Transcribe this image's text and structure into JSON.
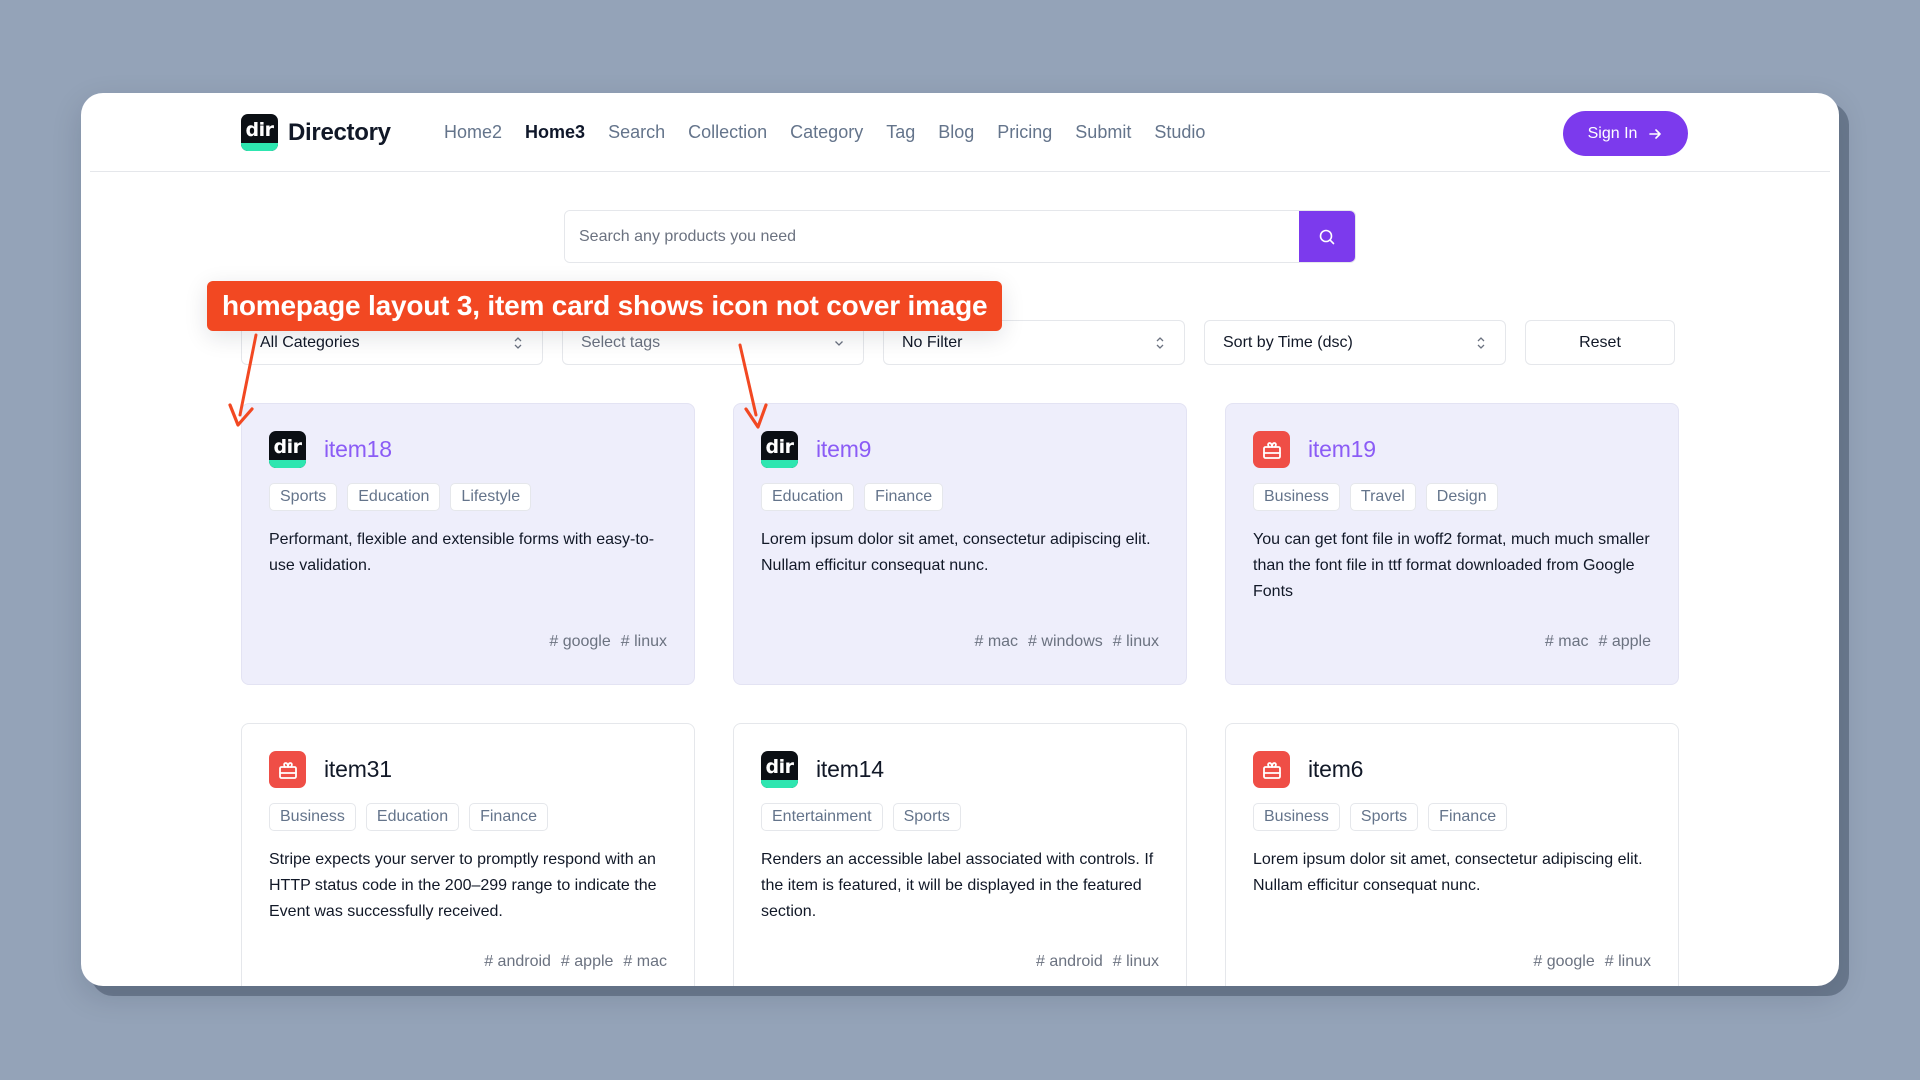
{
  "header": {
    "brand": "Directory",
    "logo_text": "dir",
    "nav": [
      {
        "label": "Home2",
        "active": false
      },
      {
        "label": "Home3",
        "active": true
      },
      {
        "label": "Search",
        "active": false
      },
      {
        "label": "Collection",
        "active": false
      },
      {
        "label": "Category",
        "active": false
      },
      {
        "label": "Tag",
        "active": false
      },
      {
        "label": "Blog",
        "active": false
      },
      {
        "label": "Pricing",
        "active": false
      },
      {
        "label": "Submit",
        "active": false
      },
      {
        "label": "Studio",
        "active": false
      }
    ],
    "signin_label": "Sign In"
  },
  "search": {
    "placeholder": "Search any products you need",
    "value": ""
  },
  "filters": {
    "category": "All Categories",
    "tags_placeholder": "Select tags",
    "filter": "No Filter",
    "sort": "Sort by Time (dsc)",
    "reset_label": "Reset"
  },
  "annotation": {
    "text": "homepage layout 3, item card shows icon not cover image"
  },
  "colors": {
    "accent": "#7c3aed",
    "featured_bg": "#eeeefb",
    "featured_title": "#8b5cf6",
    "annotation": "#f24822",
    "gift_icon": "#ef4e46",
    "dir_icon_band": "#2ee6b0"
  },
  "items": [
    {
      "title": "item18",
      "icon": "dir-app-icon",
      "featured": true,
      "categories": [
        "Sports",
        "Education",
        "Lifestyle"
      ],
      "description": "Performant, flexible and extensible forms with easy-to-use validation.",
      "tags": [
        "google",
        "linux"
      ]
    },
    {
      "title": "item9",
      "icon": "dir-app-icon",
      "featured": true,
      "categories": [
        "Education",
        "Finance"
      ],
      "description": "Lorem ipsum dolor sit amet, consectetur adipiscing elit. Nullam efficitur consequat nunc.",
      "tags": [
        "mac",
        "windows",
        "linux"
      ]
    },
    {
      "title": "item19",
      "icon": "gift-icon",
      "featured": true,
      "categories": [
        "Business",
        "Travel",
        "Design"
      ],
      "description": "You can get font file in woff2 format, much much smaller than the font file in ttf format downloaded from Google Fonts",
      "tags": [
        "mac",
        "apple"
      ]
    },
    {
      "title": "item31",
      "icon": "gift-icon",
      "featured": false,
      "categories": [
        "Business",
        "Education",
        "Finance"
      ],
      "description": "Stripe expects your server to promptly respond with an HTTP status code in the 200–299 range to indicate the Event was successfully received.",
      "tags": [
        "android",
        "apple",
        "mac"
      ]
    },
    {
      "title": "item14",
      "icon": "dir-app-icon",
      "featured": false,
      "categories": [
        "Entertainment",
        "Sports"
      ],
      "description": "Renders an accessible label associated with controls. If the item is featured, it will be displayed in the featured section.",
      "tags": [
        "android",
        "linux"
      ]
    },
    {
      "title": "item6",
      "icon": "gift-icon",
      "featured": false,
      "categories": [
        "Business",
        "Sports",
        "Finance"
      ],
      "description": "Lorem ipsum dolor sit amet, consectetur adipiscing elit. Nullam efficitur consequat nunc.",
      "tags": [
        "google",
        "linux"
      ]
    }
  ]
}
